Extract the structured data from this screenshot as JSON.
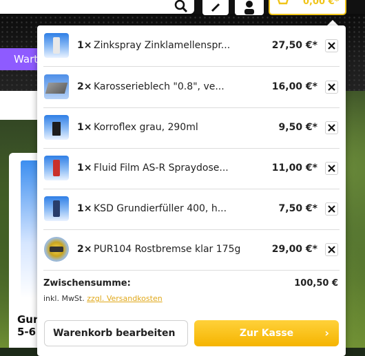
{
  "header": {
    "cart_total": "0,00 €*",
    "nav_tab_label": "Wart"
  },
  "background": {
    "product_title_lines": [
      "Gur",
      "5-6"
    ]
  },
  "cart": {
    "items": [
      {
        "qty": "1×",
        "name": "Zinkspray Zinklamellenspr...",
        "price": "27,50 €*"
      },
      {
        "qty": "2×",
        "name": "Karosserieblech \"0.8\", ve...",
        "price": "16,00 €*"
      },
      {
        "qty": "1×",
        "name": "Korroflex grau, 290ml",
        "price": "9,50 €*"
      },
      {
        "qty": "1×",
        "name": "Fluid Film AS-R Spraydose...",
        "price": "11,00 €*"
      },
      {
        "qty": "1×",
        "name": "KSD Grundierfüller 400, h...",
        "price": "7,50 €*"
      },
      {
        "qty": "2×",
        "name": "PUR104 Rostbremse klar 175g",
        "price": "29,00 €*"
      }
    ],
    "subtotal_label": "Zwischensumme:",
    "subtotal_value": "100,50 €",
    "vat_text": "inkl. MwSt.",
    "shipping_link": "zzgl. Versandkosten",
    "edit_button": "Warenkorb bearbeiten",
    "checkout_button": "Zur Kasse",
    "checkout_chevron": "›"
  },
  "colors": {
    "accent_yellow": "#f5b400",
    "link": "#e0a81a",
    "tab_purple": "#8e5bff"
  }
}
